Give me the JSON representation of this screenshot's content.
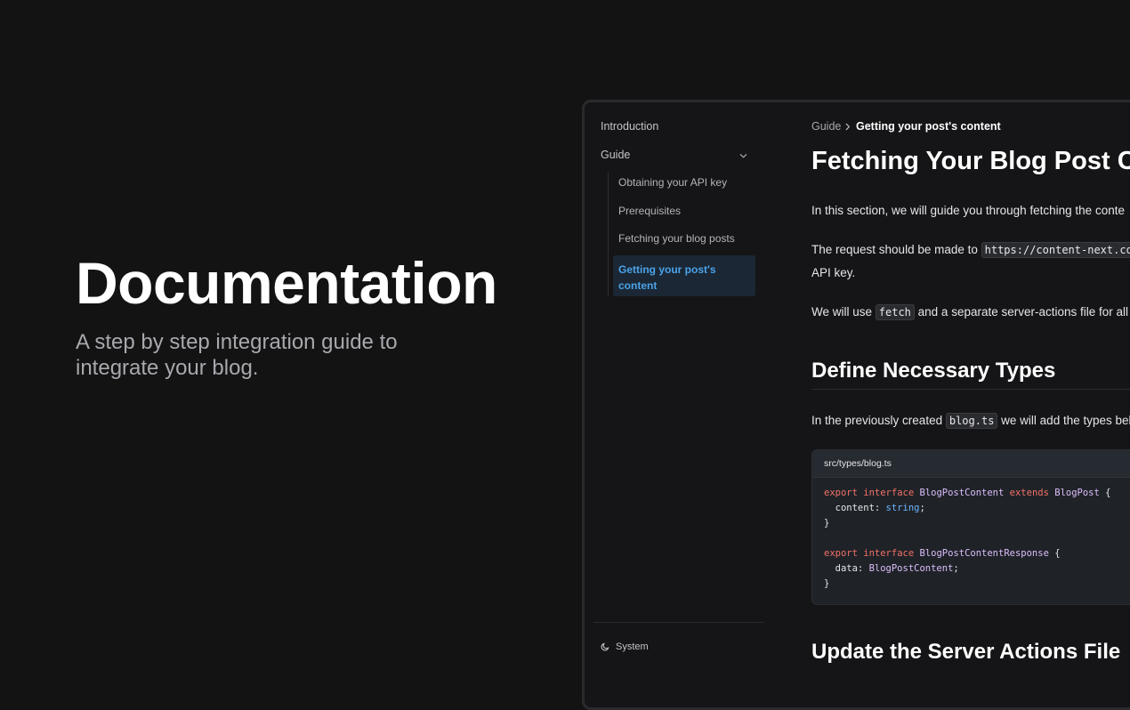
{
  "hero": {
    "title": "Documentation",
    "subtitle": "A step by step integration guide to integrate your blog."
  },
  "sidebar": {
    "introduction": "Introduction",
    "guide": "Guide",
    "sub_items": [
      "Obtaining your API key",
      "Prerequisites",
      "Fetching your blog posts",
      "Getting your post's content"
    ],
    "active_index": 3,
    "theme_label": "System"
  },
  "breadcrumb": {
    "parent": "Guide",
    "current": "Getting your post's content"
  },
  "content": {
    "title": "Fetching Your Blog Post C",
    "p1": "In this section, we will guide you through fetching the conte",
    "p2_before": "The request should be made to ",
    "p2_code": "https://content-next.com,",
    "p2_after": "API key.",
    "p3_before": "We will use ",
    "p3_code": "fetch",
    "p3_after": " and a separate server-actions file for all b",
    "h2_types": "Define Necessary Types",
    "p4_before": "In the previously created ",
    "p4_code": "blog.ts",
    "p4_after": " we will add the types bel",
    "code_file": "src/types/blog.ts",
    "code": {
      "l1_kw1": "export",
      "l1_kw2": "interface",
      "l1_name": "BlogPostContent",
      "l1_kw3": "extends",
      "l1_base": "BlogPost",
      "l1_brace": " {",
      "l2_key": "  content: ",
      "l2_type": "string",
      "l2_end": ";",
      "l3": "}",
      "l5_kw1": "export",
      "l5_kw2": "interface",
      "l5_name": "BlogPostContentResponse",
      "l5_brace": " {",
      "l6_key": "  data: ",
      "l6_type": "BlogPostContent",
      "l6_end": ";",
      "l7": "}"
    },
    "h2_update": "Update the Server Actions File"
  },
  "colors": {
    "background": "#131314",
    "accent": "#4ba3ea",
    "keyword": "#f47067",
    "type": "#dcbdfb",
    "builtin": "#6cb6ff"
  }
}
